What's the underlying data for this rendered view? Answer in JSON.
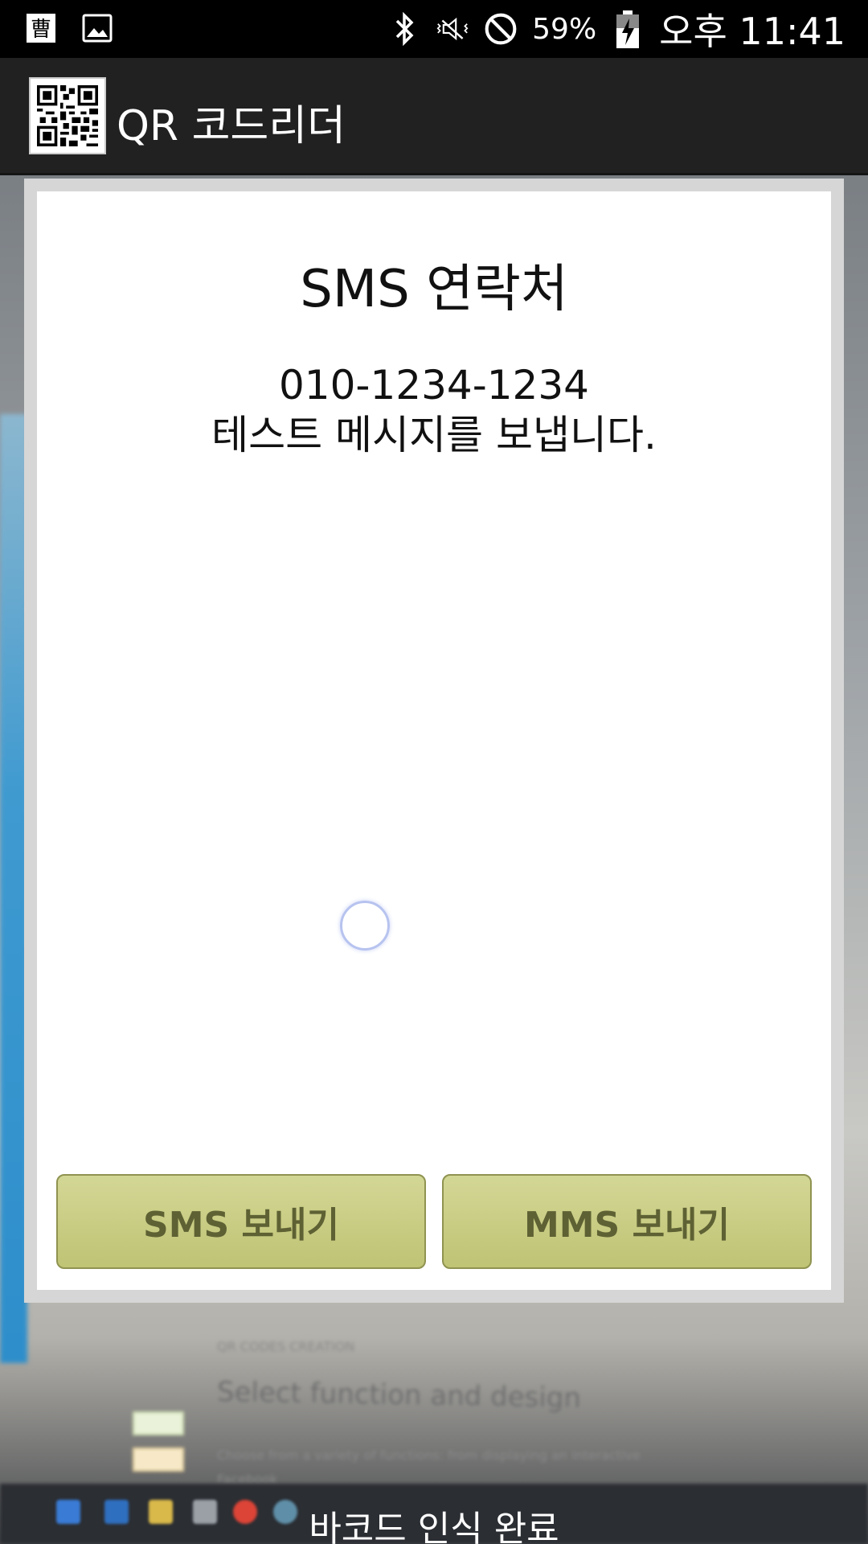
{
  "status_bar": {
    "battery_percent": "59%",
    "time": "오후 11:41",
    "icons": [
      "notification-app-icon",
      "gallery-icon",
      "bluetooth-icon",
      "vibrate-mute-icon",
      "do-not-disturb-icon",
      "battery-charging-icon"
    ]
  },
  "app_bar": {
    "title": "QR 코드리더",
    "logo_icon": "qr-code-icon"
  },
  "dialog": {
    "title": "SMS 연락처",
    "phone": "010-1234-1234",
    "message": "테스트 메시지를 보냅니다.",
    "sms_button": "SMS 보내기",
    "mms_button": "MMS 보내기",
    "button_color": "#c9cd85"
  },
  "footer": {
    "status": "바코드 인식 완료"
  },
  "background": {
    "line1": "QR CODES CREATION",
    "line2": "Select function and design",
    "line3": "Choose from a variety of functions: from displaying an interactive Facebook"
  }
}
